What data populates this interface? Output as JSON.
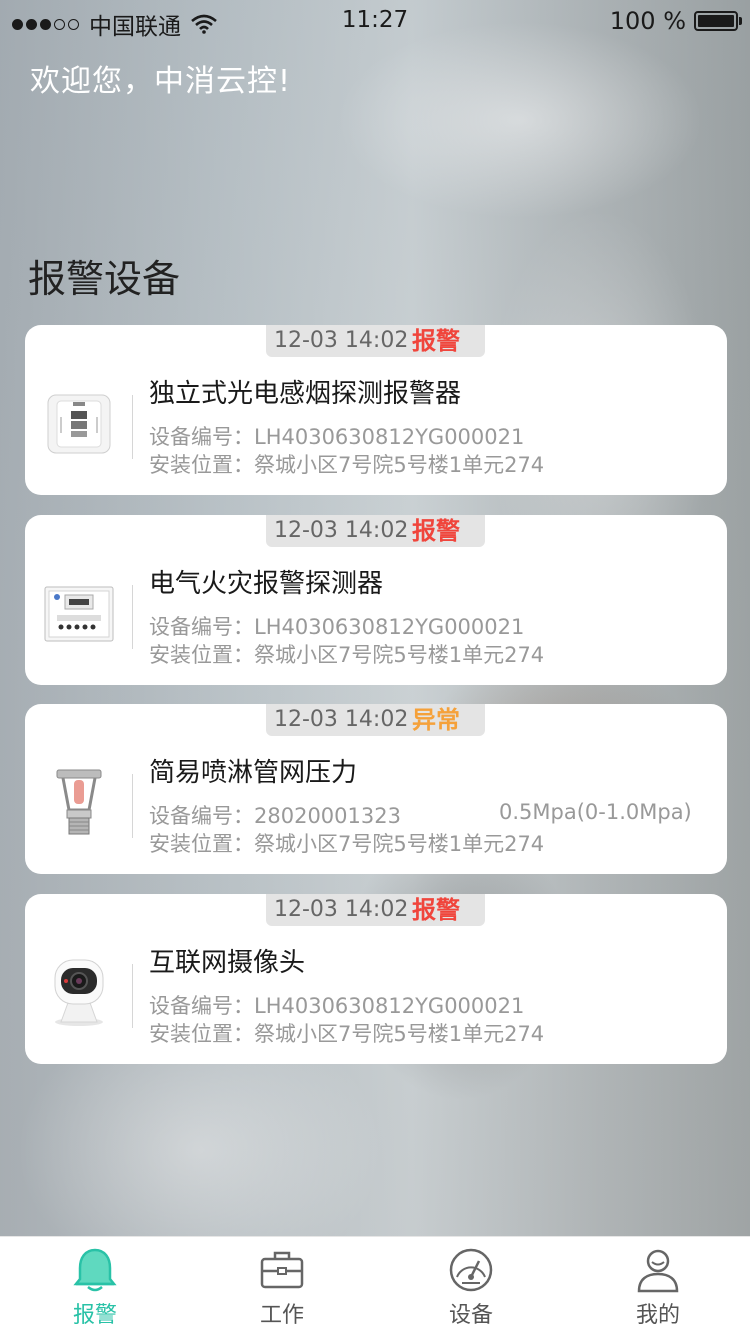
{
  "status_bar": {
    "carrier": "中国联通",
    "time": "11:27",
    "battery": "100 %"
  },
  "welcome": "欢迎您，中消云控!",
  "section_title": "报警设备",
  "labels": {
    "device_no": "设备编号：",
    "location": "安装位置："
  },
  "cards": [
    {
      "time": "12-03 14:02",
      "status": "报警",
      "status_color": "#f0453c",
      "name": "独立式光电感烟探测报警器",
      "device_no": "LH4030630812YG000021",
      "location": "祭城小区7号院5号楼1单元274",
      "icon": "smoke-detector-icon"
    },
    {
      "time": "12-03 14:02",
      "status": "报警",
      "status_color": "#f0453c",
      "name": "电气火灾报警探测器",
      "device_no": "LH4030630812YG000021",
      "location": "祭城小区7号院5号楼1单元274",
      "icon": "electrical-fire-detector-icon"
    },
    {
      "time": "12-03 14:02",
      "status": "异常",
      "status_color": "#f5a13a",
      "name": "简易喷淋管网压力",
      "device_no": "28020001323",
      "extra": "0.5Mpa(0-1.0Mpa)",
      "location": "祭城小区7号院5号楼1单元274",
      "icon": "sprinkler-head-icon"
    },
    {
      "time": "12-03 14:02",
      "status": "报警",
      "status_color": "#f0453c",
      "name": "互联网摄像头",
      "device_no": "LH4030630812YG000021",
      "location": "祭城小区7号院5号楼1单元274",
      "icon": "camera-icon"
    }
  ],
  "tabs": [
    {
      "label": "报警",
      "icon": "bell-icon",
      "active": true
    },
    {
      "label": "工作",
      "icon": "briefcase-icon",
      "active": false
    },
    {
      "label": "设备",
      "icon": "gauge-icon",
      "active": false
    },
    {
      "label": "我的",
      "icon": "user-icon",
      "active": false
    }
  ],
  "colors": {
    "accent": "#29c2a7",
    "alarm": "#f0453c",
    "abnormal": "#f5a13a"
  }
}
